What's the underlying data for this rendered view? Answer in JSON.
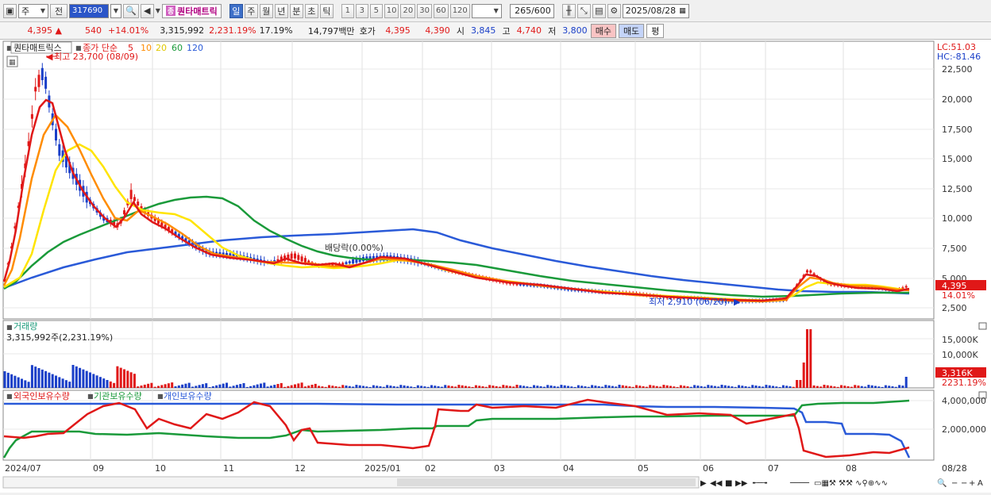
{
  "toolbar": {
    "market": "주",
    "type_label": "전",
    "code": "317690",
    "stock_name": "퀀타매트릭",
    "stock_name_prefix": "종",
    "periods": [
      "일",
      "주",
      "월",
      "년",
      "분",
      "초",
      "틱"
    ],
    "active_period": "일",
    "intervals": [
      "1",
      "3",
      "5",
      "10",
      "20",
      "30",
      "60",
      "120"
    ],
    "count": "265",
    "count_total": "/600",
    "date": "2025/08/28"
  },
  "quote": {
    "price": "4,395",
    "change": "540",
    "change_pct": "+14.01%",
    "volume": "3,315,992",
    "volume_ratio": "2,231.19%",
    "turnover": "17.19%",
    "amount": "14,797백만",
    "ask_label": "호가",
    "ask": "4,395",
    "bid": "4,390",
    "open_label": "시",
    "open": "3,845",
    "high_label": "고",
    "high": "4,740",
    "low_label": "저",
    "low": "3,800",
    "buy_label": "매수",
    "sell_label": "매도",
    "eval_label": "평"
  },
  "price_panel": {
    "legend_name": "퀀타매트릭스",
    "legend_ma": "종가 단순",
    "ma_periods": [
      "5",
      "10",
      "20",
      "60",
      "120"
    ],
    "ma_colors": [
      "#e01818",
      "#ff8c00",
      "#f0e000",
      "#1a9a3a",
      "#2a5ad8"
    ],
    "high_marker": "최고 23,700 (08/09)",
    "low_marker": "최저 2,910 (06/20)",
    "ex_div": "배당락(0.00%)",
    "lc": "LC:51.03",
    "hc": "HC:-81.46",
    "last_price_tag": "4,395",
    "last_pct_tag": "14.01%",
    "y_ticks": [
      "22,500",
      "20,000",
      "17,500",
      "15,000",
      "12,500",
      "10,000",
      "7,500",
      "5,000",
      "2,500"
    ]
  },
  "volume_panel": {
    "title": "거래량",
    "value": "3,315,992주(2,231.19%)",
    "y_ticks": [
      "15,000K",
      "10,000K"
    ],
    "last_tag": "3,316K",
    "last_pct_tag": "2231.19%"
  },
  "holding_panel": {
    "legend": [
      "외국인보유수량",
      "기관보유수량",
      "개인보유수량"
    ],
    "colors": [
      "#e01818",
      "#1a9a3a",
      "#2a5ad8"
    ],
    "y_ticks": [
      "4,000,000",
      "2,000,000"
    ]
  },
  "x_axis": {
    "labels": [
      "2024/07",
      "09",
      "10",
      "11",
      "12",
      "2025/01",
      "02",
      "03",
      "04",
      "05",
      "06",
      "07",
      "08"
    ],
    "right_label": "08/28"
  },
  "colors": {
    "up": "#e01818",
    "down": "#1a3fc8",
    "active_tab": "#3d6fc8"
  }
}
